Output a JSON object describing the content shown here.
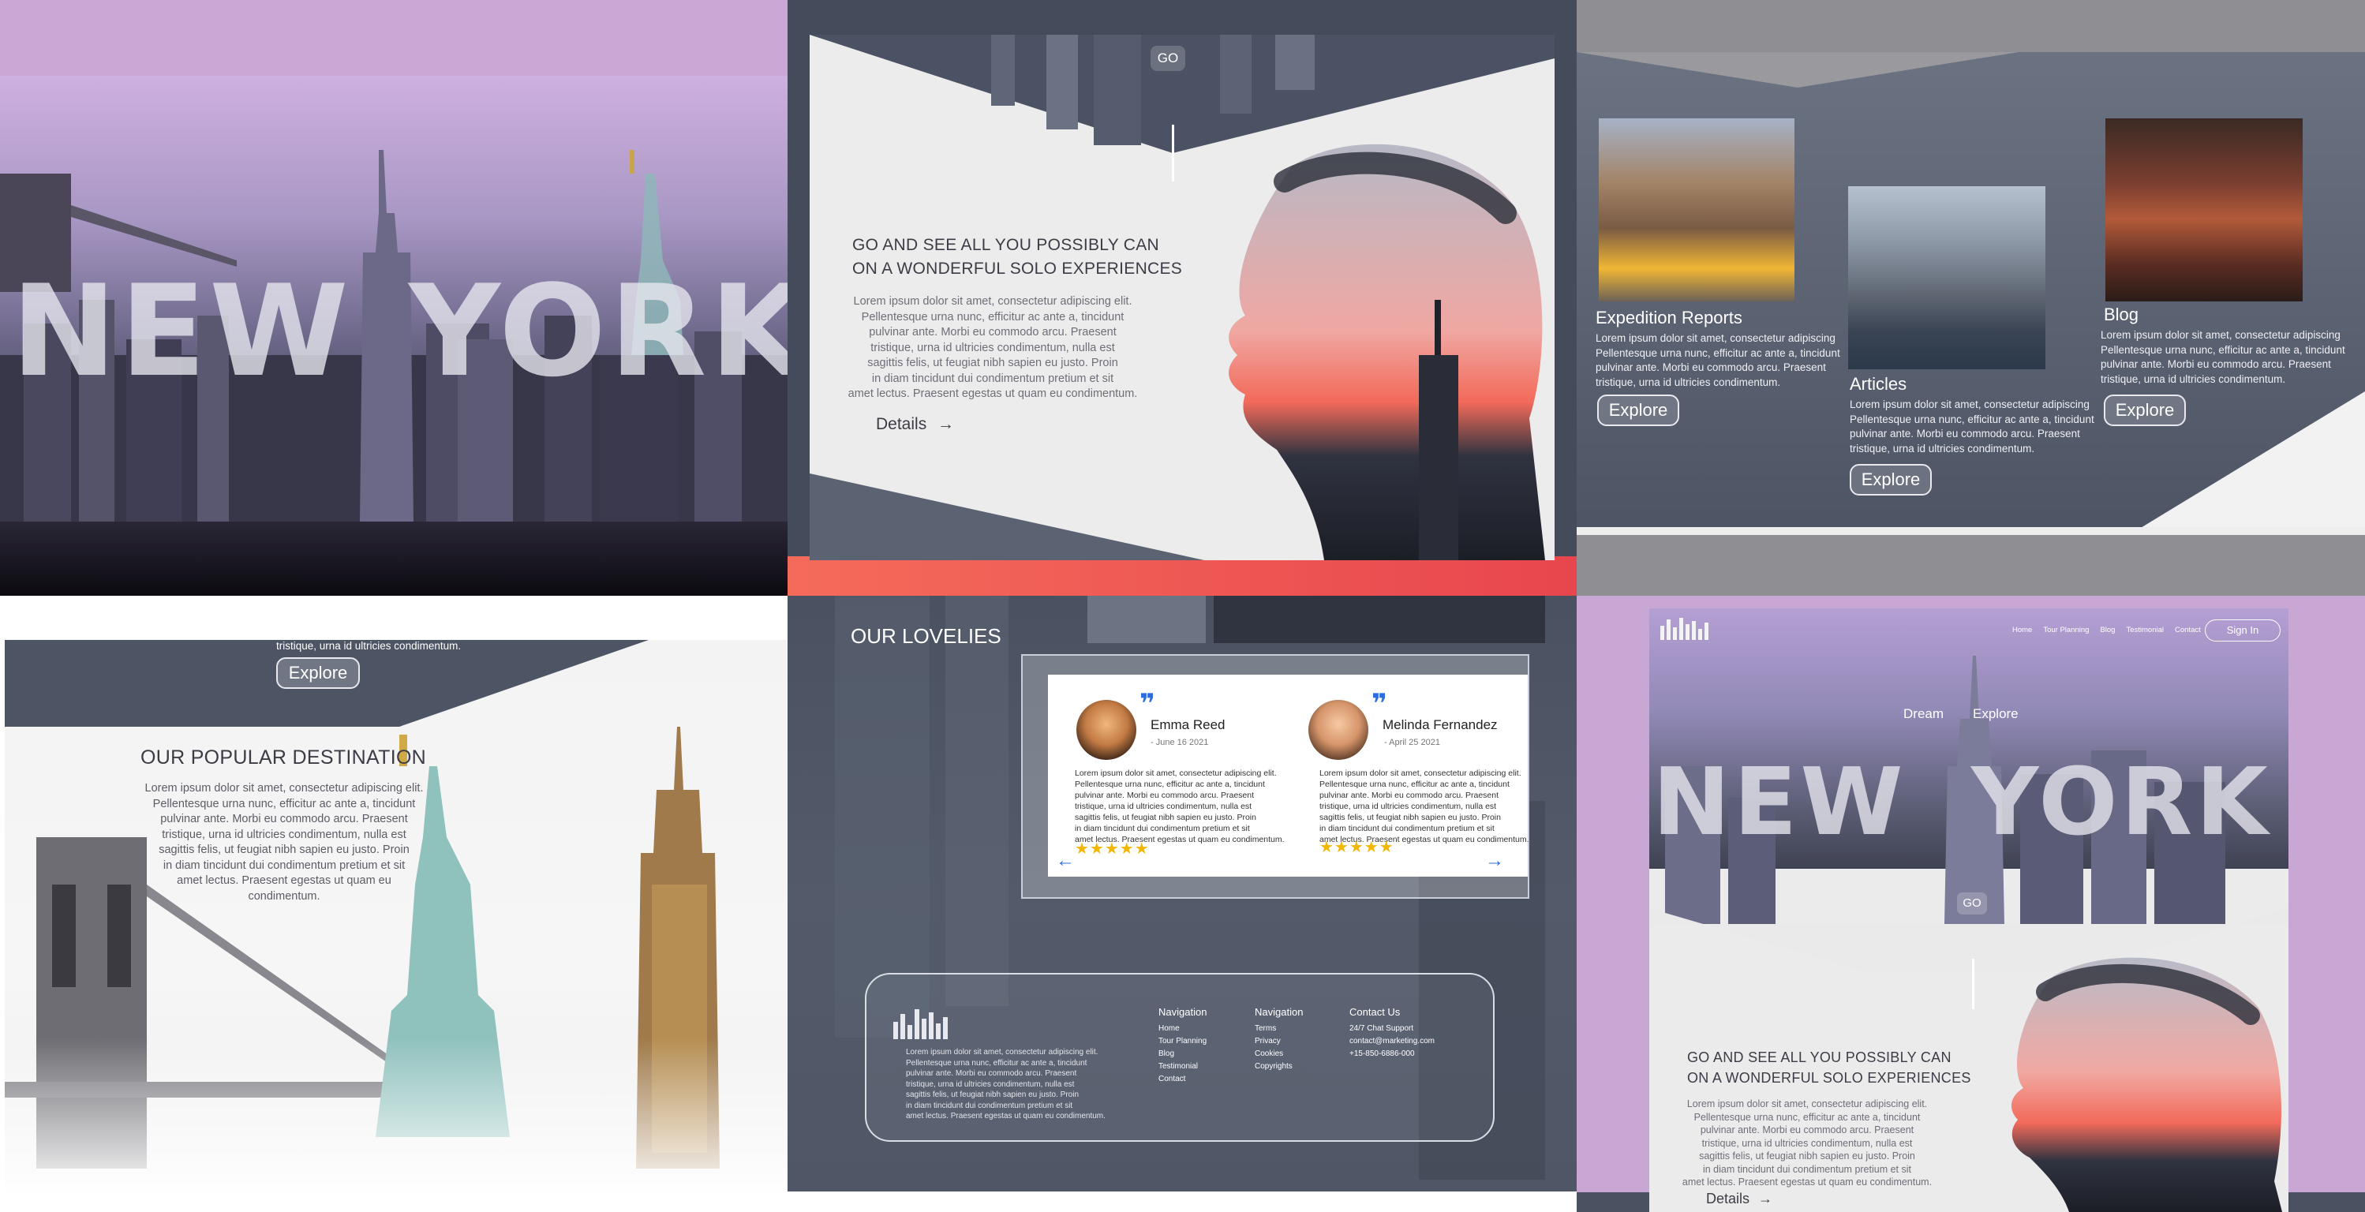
{
  "panel1": {
    "hero_word_left": "NEW",
    "hero_word_right": "YORK"
  },
  "panel2": {
    "go_label": "GO",
    "heading_line1": "GO AND SEE ALL YOU POSSIBLY CAN",
    "heading_line2": "ON A WONDERFUL SOLO EXPERIENCES",
    "body": [
      "Lorem ipsum dolor sit amet, consectetur adipiscing elit.",
      "Pellentesque urna nunc, efficitur ac ante a, tincidunt",
      "pulvinar ante. Morbi eu commodo arcu. Praesent",
      "tristique, urna id ultricies condimentum, nulla est",
      "sagittis felis, ut feugiat nibh sapien eu justo. Proin",
      "in diam tincidunt dui condimentum pretium et sit",
      "amet lectus. Praesent egestas ut quam eu condimentum."
    ],
    "details_label": "Details",
    "details_arrow": "→"
  },
  "panel3": {
    "cards": [
      {
        "title": "Expedition Reports",
        "body": [
          "Lorem ipsum dolor sit amet, consectetur adipiscing",
          "Pellentesque urna nunc, efficitur ac ante a, tincidunt",
          "pulvinar ante. Morbi eu commodo arcu. Praesent",
          "tristique, urna id ultricies condimentum."
        ],
        "button": "Explore"
      },
      {
        "title": "Articles",
        "body": [
          "Lorem ipsum dolor sit amet, consectetur adipiscing",
          "Pellentesque urna nunc, efficitur ac ante a, tincidunt",
          "pulvinar ante. Morbi eu commodo arcu. Praesent",
          "tristique, urna id ultricies condimentum."
        ],
        "button": "Explore"
      },
      {
        "title": "Blog",
        "body": [
          "Lorem ipsum dolor sit amet, consectetur adipiscing",
          "Pellentesque urna nunc, efficitur ac ante a, tincidunt",
          "pulvinar ante. Morbi eu commodo arcu. Praesent",
          "tristique, urna id ultricies condimentum."
        ],
        "button": "Explore"
      }
    ]
  },
  "panel4": {
    "top_text": "tristique, urna id ultricies condimentum.",
    "explore_label": "Explore",
    "heading": "OUR POPULAR DESTINATION",
    "body": [
      "Lorem ipsum dolor sit amet, consectetur adipiscing elit.",
      "Pellentesque urna nunc, efficitur ac ante a, tincidunt",
      "pulvinar ante. Morbi eu commodo arcu. Praesent",
      "tristique, urna id ultricies condimentum, nulla est",
      "sagittis felis, ut feugiat nibh sapien eu justo. Proin",
      "in diam tincidunt dui condimentum pretium et sit",
      "amet lectus. Praesent egestas ut quam eu condimentum."
    ]
  },
  "panel5": {
    "section_title": "OUR LOVELIES",
    "reviews": [
      {
        "name": "Emma Reed",
        "date": "- June 16 2021",
        "body": [
          "Lorem ipsum dolor sit amet, consectetur adipiscing elit.",
          "Pellentesque urna nunc, efficitur ac ante a, tincidunt",
          "pulvinar ante. Morbi eu commodo arcu. Praesent",
          "tristique, urna id ultricies condimentum, nulla est",
          "sagittis felis, ut feugiat nibh sapien eu justo. Proin",
          "in diam tincidunt dui condimentum pretium et sit",
          "amet lectus. Praesent egestas ut quam eu condimentum."
        ],
        "stars": "★★★★★"
      },
      {
        "name": "Melinda Fernandez",
        "date": "- April 25 2021",
        "body": [
          "Lorem ipsum dolor sit amet, consectetur adipiscing elit.",
          "Pellentesque urna nunc, efficitur ac ante a, tincidunt",
          "pulvinar ante. Morbi eu commodo arcu. Praesent",
          "tristique, urna id ultricies condimentum, nulla est",
          "sagittis felis, ut feugiat nibh sapien eu justo. Proin",
          "in diam tincidunt dui condimentum pretium et sit",
          "amet lectus. Praesent egestas ut quam eu condimentum."
        ],
        "stars": "★★★★★"
      }
    ],
    "prev_arrow": "←",
    "next_arrow": "→",
    "footer": {
      "about": [
        "Lorem ipsum dolor sit amet, consectetur adipiscing elit.",
        "Pellentesque urna nunc, efficitur ac ante a, tincidunt",
        "pulvinar ante. Morbi eu commodo arcu. Praesent",
        "tristique, urna id ultricies condimentum, nulla est",
        "sagittis felis, ut feugiat nibh sapien eu justo. Proin",
        "in diam tincidunt dui condimentum pretium et sit",
        "amet lectus. Praesent egestas ut quam eu condimentum."
      ],
      "col1_title": "Navigation",
      "col1_links": [
        "Home",
        "Tour Planning",
        "Blog",
        "Testimonial",
        "Contact"
      ],
      "col2_title": "Navigation",
      "col2_links": [
        "Terms",
        "Privacy",
        "Cookies",
        "Copyrights"
      ],
      "col3_title": "Contact Us",
      "col3_links": [
        "24/7 Chat Support",
        "contact@marketing.com",
        "+15-850-6886-000"
      ]
    }
  },
  "panel6": {
    "nav": [
      "Home",
      "Tour Planning",
      "Blog",
      "Testimonial",
      "Contact"
    ],
    "sign_in": "Sign In",
    "tagline_left": "Dream",
    "tagline_right": "Explore",
    "hero_word_left": "NEW",
    "hero_word_right": "YORK",
    "go_label": "GO",
    "heading_line1": "GO AND SEE ALL YOU POSSIBLY CAN",
    "heading_line2": "ON A WONDERFUL SOLO EXPERIENCES",
    "body": [
      "Lorem ipsum dolor sit amet, consectetur adipiscing elit.",
      "Pellentesque urna nunc, efficitur ac ante a, tincidunt",
      "pulvinar ante. Morbi eu commodo arcu. Praesent",
      "tristique, urna id ultricies condimentum, nulla est",
      "sagittis felis, ut feugiat nibh sapien eu justo. Proin",
      "in diam tincidunt dui condimentum pretium et sit",
      "amet lectus. Praesent egestas ut quam eu condimentum."
    ],
    "details_label": "Details",
    "details_arrow": "→"
  },
  "colors": {
    "lavender": "#c9a6d3",
    "slate": "#4a5362",
    "dark_slate": "#2e3440",
    "sunset": "#f26a5a",
    "star_gold": "#f2b705",
    "accent_blue": "#2d6cdf"
  }
}
